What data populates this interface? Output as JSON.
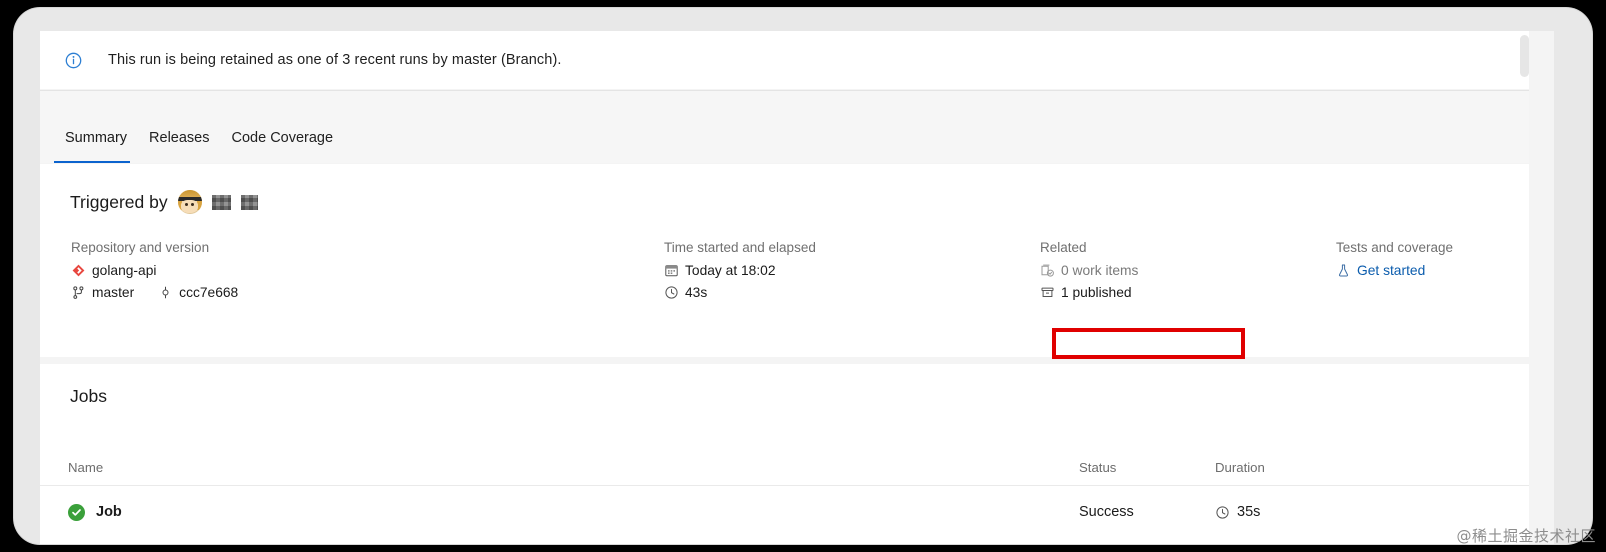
{
  "banner": {
    "icon": "info-circle-icon",
    "message": "This run is being retained as one of 3 recent runs by master (Branch)."
  },
  "tabs": [
    {
      "label": "Summary",
      "selected": true
    },
    {
      "label": "Releases",
      "selected": false
    },
    {
      "label": "Code Coverage",
      "selected": false
    }
  ],
  "summary": {
    "triggered_by_label": "Triggered by",
    "avatar": "user-avatar",
    "user_name_redacted": "",
    "columns": {
      "repository": {
        "heading": "Repository and version",
        "repo_icon": "azure-repos-icon",
        "repo_name": "golang-api",
        "branch_icon": "branch-icon",
        "branch_name": "master",
        "commit_icon": "commit-icon",
        "commit_hash": "ccc7e668"
      },
      "time": {
        "heading": "Time started and elapsed",
        "calendar_icon": "calendar-icon",
        "started": "Today at 18:02",
        "clock_icon": "clock-icon",
        "elapsed": "43s"
      },
      "related": {
        "heading": "Related",
        "work_items_icon": "work-item-icon",
        "work_items": "0 work items",
        "artifacts_icon": "package-icon",
        "artifacts": "1 published"
      },
      "tests": {
        "heading": "Tests and coverage",
        "beaker_icon": "beaker-icon",
        "link_label": "Get started"
      }
    }
  },
  "jobs": {
    "title": "Jobs",
    "headers": {
      "name": "Name",
      "status": "Status",
      "duration": "Duration"
    },
    "rows": [
      {
        "status_icon": "success-check-icon",
        "name": "Job",
        "status": "Success",
        "duration_icon": "clock-icon",
        "duration": "35s"
      }
    ]
  },
  "watermark": "@稀土掘金技术社区",
  "colors": {
    "accent_blue": "#0b63ce",
    "link_blue": "#0b5cad",
    "success_green": "#3aa03a",
    "annotation_red": "#e00000",
    "muted_text": "#707070"
  }
}
